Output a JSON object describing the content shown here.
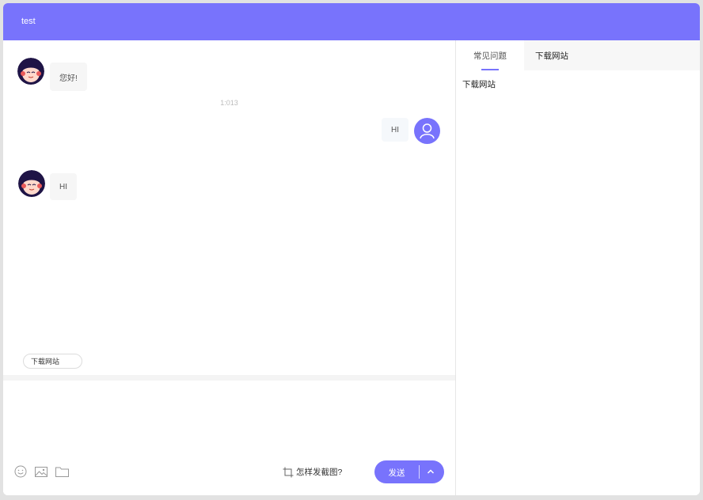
{
  "header": {
    "title": "test"
  },
  "messages": [
    {
      "from": "agent",
      "text": "您好!"
    },
    {
      "from": "user",
      "text": "HI"
    },
    {
      "from": "agent",
      "text": "HI"
    }
  ],
  "timestamp": "1:013",
  "quick_reply": "下载网站",
  "toolbar": {
    "emoji_icon": "smiley-icon",
    "image_icon": "image-icon",
    "file_icon": "folder-icon",
    "screenshot_help": "怎样发截图?",
    "send_label": "发送"
  },
  "side": {
    "tabs": [
      {
        "label": "常见问题"
      },
      {
        "label": "下载网站"
      }
    ],
    "content": "下载网站"
  },
  "colors": {
    "accent": "#7873fc"
  }
}
